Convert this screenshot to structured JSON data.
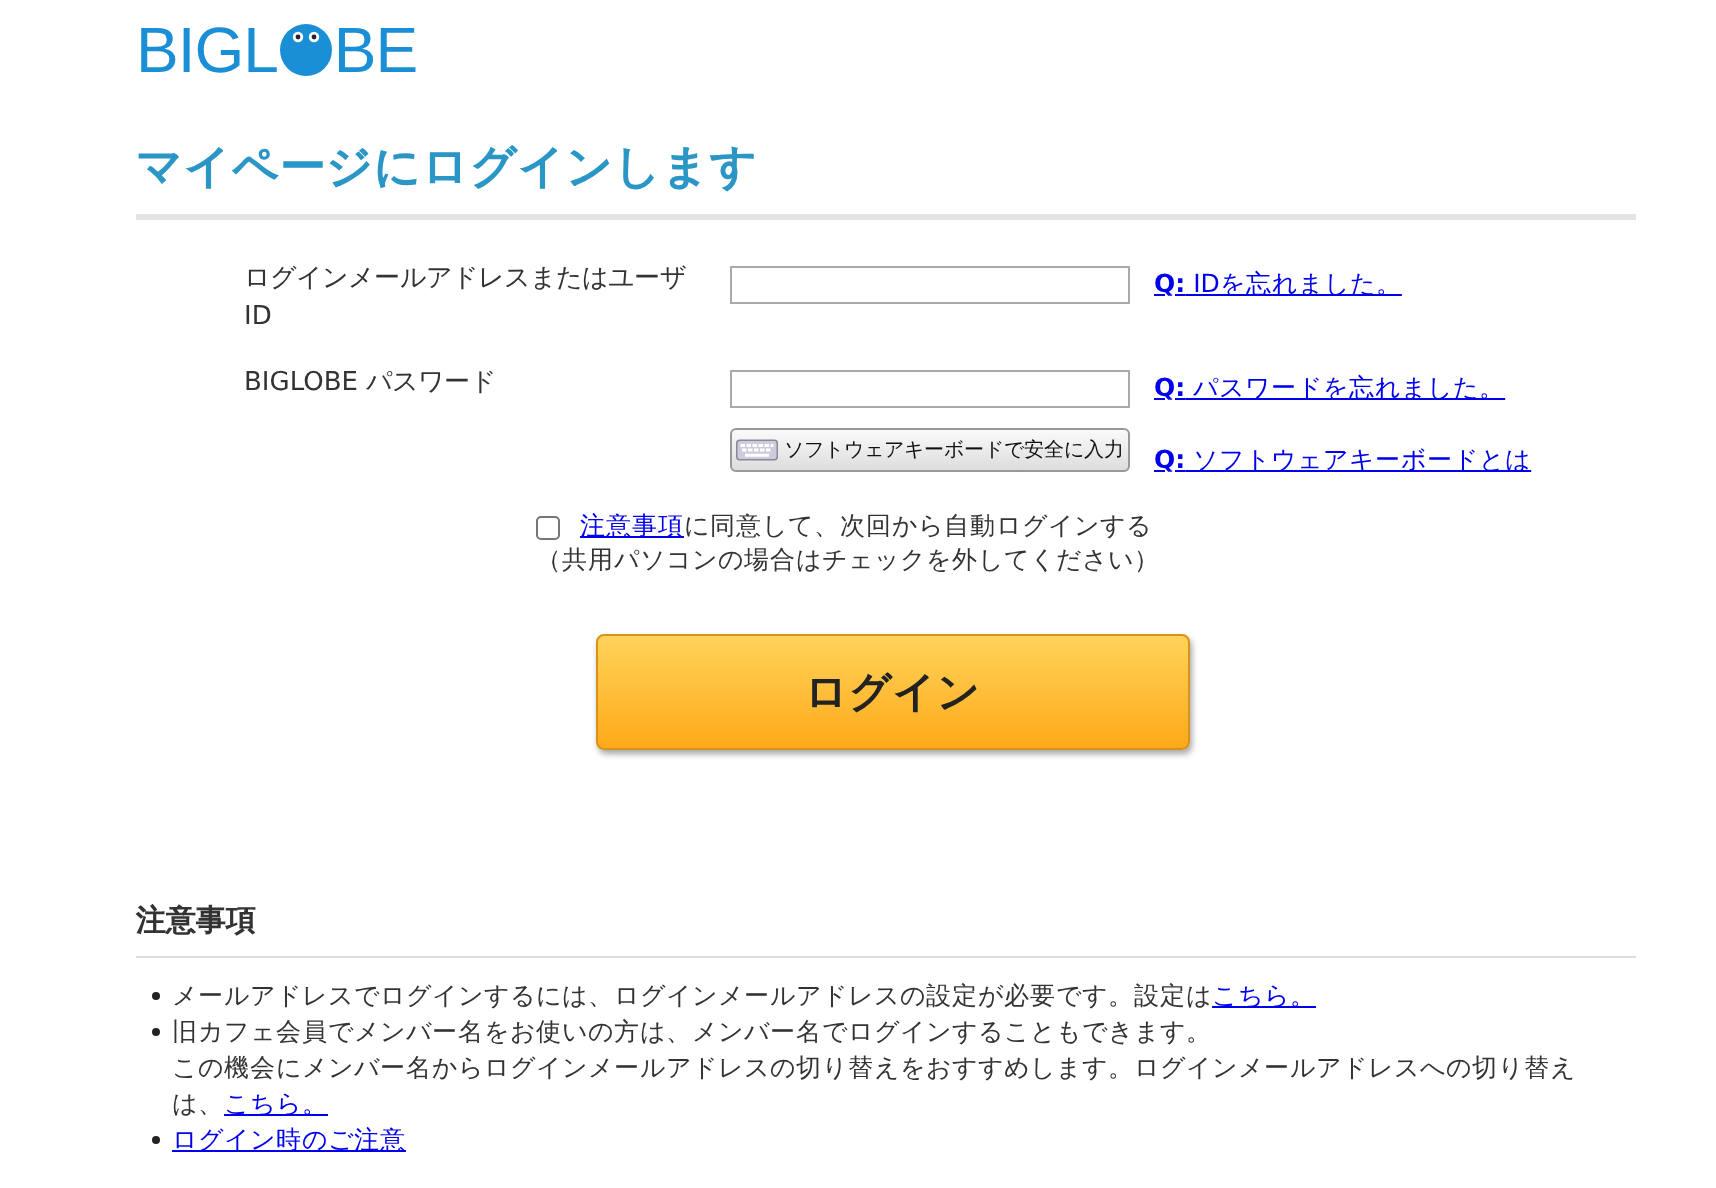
{
  "logo": {
    "before": "BIGL",
    "after": "BE"
  },
  "title": "マイページにログインします",
  "form": {
    "fields": [
      {
        "label": "ログインメールアドレスまたはユーザID",
        "help_prefix": "Q:",
        "help": "IDを忘れました。"
      },
      {
        "label": "BIGLOBE パスワード",
        "help_prefix": "Q:",
        "help": "パスワードを忘れました。"
      }
    ],
    "keyboard_button": "ソフトウェアキーボードで安全に入力",
    "keyboard_help_prefix": "Q:",
    "keyboard_help": "ソフトウェアキーボードとは",
    "auto_login": {
      "checked": false,
      "link": "注意事項",
      "text": "に同意して、次回から自動ログインする",
      "note": "（共用パソコンの場合はチェックを外してください）"
    },
    "login_button": "ログイン"
  },
  "notes": {
    "heading": "注意事項",
    "items": [
      {
        "segments": [
          {
            "kind": "text",
            "text": "メールアドレスでログインするには、ログインメールアドレスの設定が必要です。設定は"
          },
          {
            "kind": "link",
            "text": "こちら。"
          }
        ]
      },
      {
        "segments": [
          {
            "kind": "text",
            "text": "旧カフェ会員でメンバー名をお使いの方は、メンバー名でログインすることもできます。"
          },
          {
            "kind": "break"
          },
          {
            "kind": "text",
            "text": "この機会にメンバー名からログインメールアドレスの切り替えをおすすめします。ログインメールアドレスへの切り替えは、"
          },
          {
            "kind": "link",
            "text": "こちら。"
          }
        ]
      },
      {
        "segments": [
          {
            "kind": "link",
            "text": "ログイン時のご注意"
          }
        ]
      }
    ]
  }
}
